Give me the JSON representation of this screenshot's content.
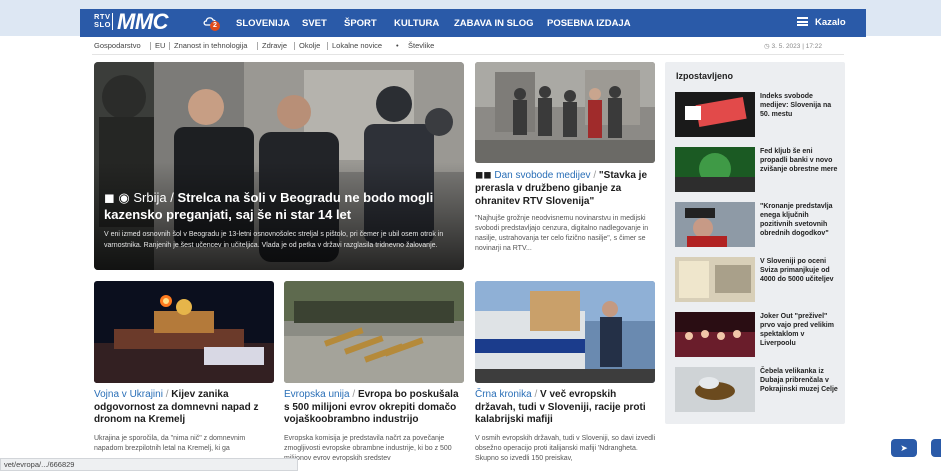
{
  "header": {
    "logo_rtv": "RTV",
    "logo_slo": "SLO",
    "logo_mmc": "MMC",
    "weather_badge": "2",
    "nav": [
      "SLOVENIJA",
      "SVET",
      "ŠPORT",
      "KULTURA",
      "ZABAVA IN SLOG",
      "POSEBNA IZDAJA"
    ],
    "menu_label": "Kazalo"
  },
  "subnav": {
    "items": [
      "Gospodarstvo",
      "EU",
      "Znanost in tehnologija",
      "Zdravje",
      "Okolje",
      "Lokalne novice",
      "Števlike"
    ],
    "date": "3. 5. 2023 | 17:22"
  },
  "hero": {
    "category": "Srbija",
    "title": "Strelca na šoli v Beogradu ne bodo mogli kazensko preganjati, saj še ni star 14 let",
    "lead": "V eni izmed osnovnih šol v Beogradu je 13-letni osnovnošolec streljal s pištolo, pri čemer je ubil osem otrok in varnostnika. Ranjenih je šest učencev in učiteljica. Vlada je od petka v državi razglasila tridnevno žalovanje."
  },
  "press_article": {
    "category": "Dan svobode medijev",
    "title": "\"Stavka je prerasla v družbeno gibanje za ohranitev RTV Slovenija\"",
    "lead": "\"Najhujše grožnje neodvisnemu novinarstvu in medijski svobodi predstavljajo cenzura, digitalno nadlegovanje in nasilje, ustrahovanja ter celo fizično nasilje\", s čimer se novinarji na RTV..."
  },
  "cards": [
    {
      "category": "Vojna v Ukrajini",
      "title": "Kijev zanika odgovornost za domnevni napad z dronom na Kremelj",
      "lead": "Ukrajina je sporočila, da \"nima nič\" z domnevnim napadom brezpilotnih letal na Kremelj, ki ga"
    },
    {
      "category": "Evropska unija",
      "title": "Evropa bo poskušala s 500 milijoni evrov okrepiti domačo vojaškoobrambno industrijo",
      "lead": "Evropska komisija je predstavila načrt za povečanje zmogljivosti evropske obrambne industrije, ki bo z 500 milijonov evrov evropskih sredstev"
    },
    {
      "category": "Črna kronika",
      "title": "V več evropskih državah, tudi v Sloveniji, racije proti kalabrijski mafiji",
      "lead": "V osmih evropskih državah, tudi v Sloveniji, so davi izvedli obsežno operacijo proti italijanski mafiji 'Ndrangheta. Skupno so izvedli 150 preiskav,"
    }
  ],
  "sidebar": {
    "heading": "Izpostavljeno",
    "items": [
      "Indeks svobode medijev: Slovenija na 50. mestu",
      "Fed kljub še eni propadli banki v novo zvišanje obrestne mere",
      "\"Kronanje predstavlja enega ključnih pozitivnih svetovnih obrednih dogodkov\"",
      "V Sloveniji po oceni Sviza primanjkuje od 4000 do 5000 učiteljev",
      "Joker Out \"preživel\" prvo vajo pred velikim spektaklom v Liverpoolu",
      "Čebela velikanka iz Dubaja pribrenčala v Pokrajinski muzej Celje"
    ]
  },
  "status_url": "vet/evropa/.../666829"
}
